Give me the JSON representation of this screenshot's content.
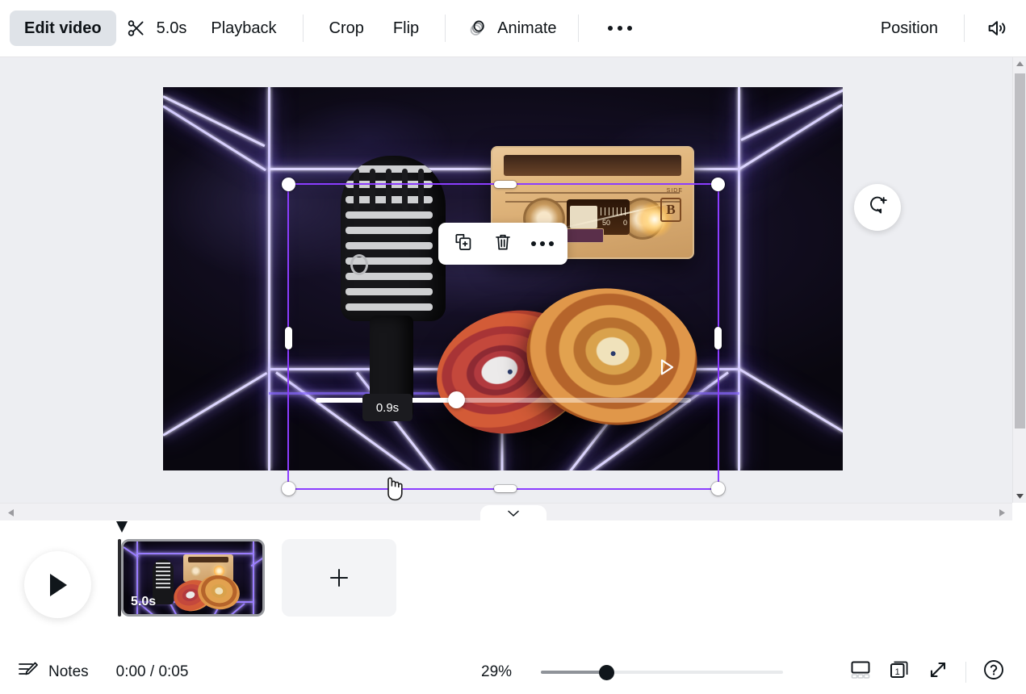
{
  "toolbar": {
    "edit_video_label": "Edit video",
    "scissors_icon": "scissors-icon",
    "duration_label": "5.0s",
    "playback_label": "Playback",
    "crop_label": "Crop",
    "flip_label": "Flip",
    "animate_icon": "animate-circles-icon",
    "animate_label": "Animate",
    "more_icon": "more-horizontal-icon",
    "position_label": "Position",
    "volume_icon": "speaker-volume-icon"
  },
  "canvas": {
    "context_menu": {
      "duplicate_icon": "duplicate-icon",
      "delete_icon": "trash-icon",
      "more_icon": "more-horizontal-icon"
    },
    "comment_button_icon": "add-comment-icon",
    "loop_button_icon": "loop-refresh-icon",
    "play_overlay_icon": "play-triangle-icon",
    "scrub_tooltip": "0.9s",
    "cursor_icon": "pointer-hand-cursor",
    "selection": {
      "handle_icon": "resize-handle",
      "border_color": "#8b3dff"
    },
    "scene_art": {
      "cassette_side_word": "SIDE",
      "cassette_side_letter": "B",
      "cassette_counter_left": "50",
      "cassette_counter_right": "0"
    }
  },
  "scrollbars": {
    "v_up_icon": "chevron-up-icon",
    "v_down_icon": "chevron-down-icon",
    "h_left_icon": "chevron-left-icon",
    "h_right_icon": "chevron-right-icon",
    "collapse_icon": "chevron-down-icon"
  },
  "timeline": {
    "play_button_icon": "play-triangle-icon",
    "playhead_icon": "playhead-marker",
    "scene_duration": "5.0s",
    "add_scene_icon": "plus-icon"
  },
  "bottom_bar": {
    "notes_icon": "notes-pencil-icon",
    "notes_label": "Notes",
    "time_display": "0:00 / 0:05",
    "zoom_percent": "29%",
    "zoom_slider_icon": "zoom-slider",
    "grid_view_icon": "grid-view-icon",
    "pages_count": "1",
    "pages_icon": "pages-stack-icon",
    "fullscreen_icon": "expand-fullscreen-icon",
    "help_icon": "help-question-icon"
  },
  "colors": {
    "accent_purple": "#8b3dff",
    "toolbar_active_bg": "#dfe3e8",
    "canvas_bg": "#edeef2"
  }
}
